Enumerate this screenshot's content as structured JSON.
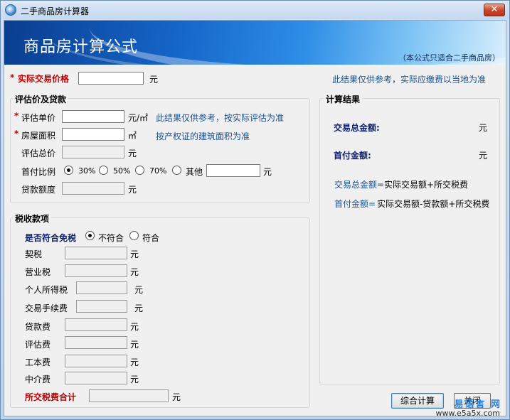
{
  "window": {
    "title": "二手商品房计算器",
    "close_glyph": "✕"
  },
  "banner": {
    "title": "商品房计算公式",
    "note": "（本公式只适合二手商品房）"
  },
  "top": {
    "required_mark": "*",
    "price_label": "实际交易价格",
    "unit_yuan": "元",
    "hint": "此结果仅供参考，实际应缴费以当地为准"
  },
  "valuation": {
    "title": "评估价及贷款",
    "unit_price_label": "评估单价",
    "unit_price_unit": "元/㎡",
    "unit_price_hint": "此结果仅供参考，按实际评估为准",
    "area_label": "房屋面积",
    "area_unit": "㎡",
    "area_hint": "按产权证的建筑面积为准",
    "total_label": "评估总价",
    "total_unit": "元",
    "down_ratio_label": "首付比例",
    "ratio_options": [
      "30%",
      "50%",
      "70%",
      "其他"
    ],
    "ratio_selected": "30%",
    "ratio_unit": "元",
    "loan_label": "贷款额度",
    "loan_unit": "元"
  },
  "tax": {
    "title": "税收款项",
    "exempt_label": "是否符合免税",
    "exempt_options": [
      "不符合",
      "符合"
    ],
    "exempt_selected": "不符合",
    "rows": [
      {
        "label": "契税",
        "unit": "元"
      },
      {
        "label": "营业税",
        "unit": "元"
      },
      {
        "label": "个人所得税",
        "unit": "元"
      },
      {
        "label": "交易手续费",
        "unit": "元"
      },
      {
        "label": "贷款费",
        "unit": "元"
      },
      {
        "label": "评估费",
        "unit": "元"
      },
      {
        "label": "工本费",
        "unit": "元"
      },
      {
        "label": "中介费",
        "unit": "元"
      }
    ],
    "total_label": "所交税费合计",
    "total_unit": "元"
  },
  "result": {
    "title": "计算结果",
    "total_label": "交易总金额:",
    "total_unit": "元",
    "down_label": "首付金额:",
    "down_unit": "元",
    "formula1_name": "交易总金额=",
    "formula1_expr": "实际交易额+所交税费",
    "formula2_name": "首付金额=",
    "formula2_expr": "实际交易额-贷款额+所交税费"
  },
  "buttons": {
    "calc": "综合计算",
    "close": "关闭"
  },
  "watermark": {
    "line1": "易语言  网",
    "line2": "www.e5a5x.com"
  },
  "colors": {
    "required": "#c00000",
    "hint_blue": "#1a4f8a",
    "result_navy": "#0c1f6e"
  }
}
